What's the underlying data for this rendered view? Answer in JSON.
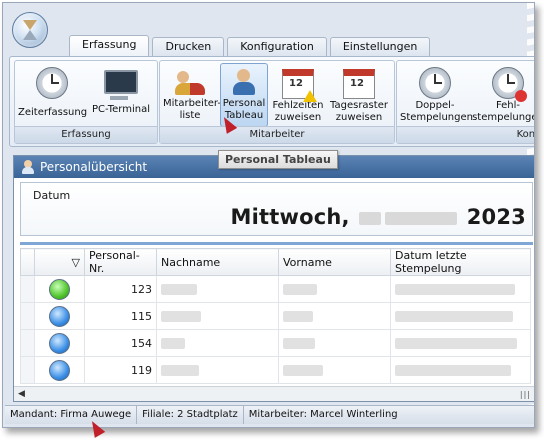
{
  "tabs": [
    {
      "label": "Erfassung",
      "active": true
    },
    {
      "label": "Drucken",
      "active": false
    },
    {
      "label": "Konfiguration",
      "active": false
    },
    {
      "label": "Einstellungen",
      "active": false
    }
  ],
  "ribbon": {
    "groups": {
      "erfassung": {
        "label": "Erfassung",
        "buttons": [
          {
            "label": "Zeiterfassung",
            "icon": "clock-icon"
          },
          {
            "label": "PC-Terminal",
            "icon": "computer-icon"
          }
        ]
      },
      "mitarbeiter": {
        "label": "Mitarbeiter",
        "buttons": [
          {
            "label_line1": "Mitarbeiter-",
            "label_line2": "liste",
            "icon": "people-icon"
          },
          {
            "label_line1": "Personal",
            "label_line2": "Tableau",
            "icon": "person-clock-icon",
            "highlighted": true
          },
          {
            "label_line1": "Fehlzeiten",
            "label_line2": "zuweisen",
            "icon": "calendar-warning-icon"
          },
          {
            "label_line1": "Tagesraster",
            "label_line2": "zuweisen",
            "icon": "calendar-clock-icon"
          }
        ]
      },
      "kontrolle": {
        "label": "Kont",
        "buttons": [
          {
            "label_line1": "Doppel-",
            "label_line2": "Stempelungen",
            "icon": "double-clock-icon"
          },
          {
            "label_line1": "Fehl-",
            "label_line2": "stempelungen",
            "icon": "clock-error-icon"
          }
        ]
      }
    }
  },
  "tooltip": {
    "text": "Personal Tableau"
  },
  "document": {
    "title": "Personalübersicht",
    "date_label": "Datum",
    "date_weekday": "Mittwoch,",
    "date_year": "2023"
  },
  "grid": {
    "columns": [
      "",
      "Personal-Nr.",
      "Nachname",
      "Vorname",
      "Datum letzte Stempelung"
    ],
    "rows": [
      {
        "status": "green",
        "nr": "123"
      },
      {
        "status": "blue",
        "nr": "115"
      },
      {
        "status": "blue",
        "nr": "154"
      },
      {
        "status": "blue",
        "nr": "119"
      }
    ]
  },
  "colors": {
    "accent": "#3a6396",
    "status_green": "#4fc42a",
    "status_blue": "#3b8fe6"
  },
  "statusbar": {
    "mandant": "Mandant: Firma Auwege",
    "filiale": "Filiale: 2 Stadtplatz",
    "mitarbeiter": "Mitarbeiter: Marcel Winterling"
  }
}
